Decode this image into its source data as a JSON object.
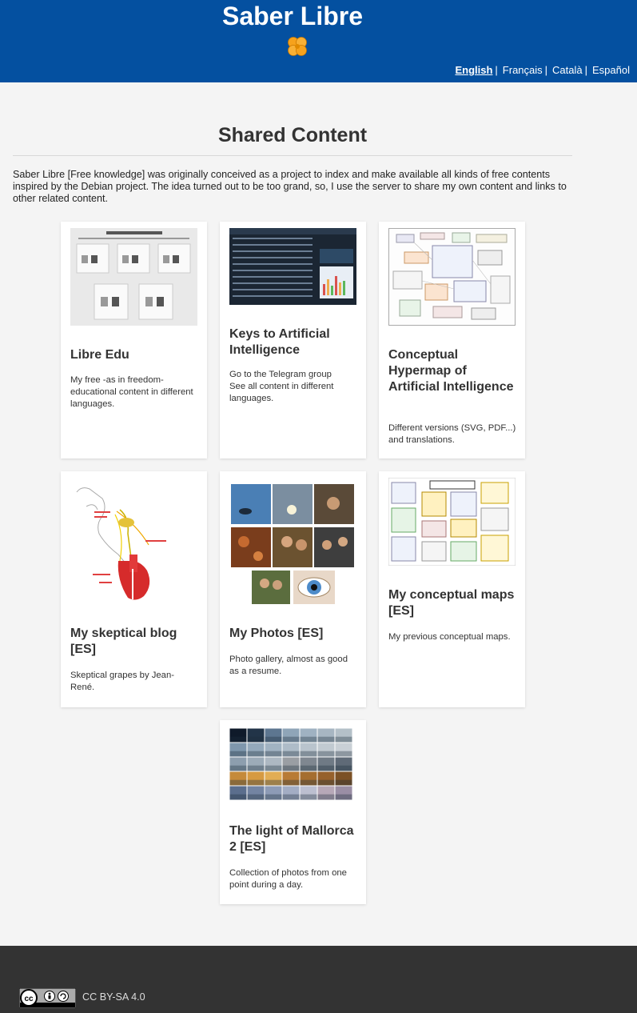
{
  "header": {
    "site_title": "Saber Libre",
    "languages": [
      {
        "label": "English",
        "active": true
      },
      {
        "label": "Français",
        "active": false
      },
      {
        "label": "Català",
        "active": false
      },
      {
        "label": "Español",
        "active": false
      }
    ],
    "separator": "|"
  },
  "main": {
    "title": "Shared Content",
    "intro": "Saber Libre [Free knowledge] was originally conceived as a project to index and make available all kinds of free contents inspired by the Debian project. The idea turned out to be too grand, so, I use the server to share my own content and links to other related content.",
    "cards": [
      {
        "title": "Libre Edu",
        "text": [
          "My free -as in freedom- educational content in different languages."
        ]
      },
      {
        "title": "Keys to Artificial Intelligence",
        "text": [
          "Go to the Telegram group",
          "See all content in different languages."
        ]
      },
      {
        "title": "Conceptual Hypermap of Artificial Intelligence",
        "text": [
          "Different versions (SVG, PDF...) and translations."
        ]
      },
      {
        "title": "My skeptical blog [ES]",
        "text": [
          "Skeptical grapes by Jean-René."
        ]
      },
      {
        "title": "My Photos [ES]",
        "text": [
          "Photo gallery, almost as good as a resume."
        ]
      },
      {
        "title": "My conceptual maps [ES]",
        "text": [
          "My previous conceptual maps."
        ]
      },
      {
        "title": "The light of Mallorca 2 [ES]",
        "text": [
          "Collection of photos from one point during a day."
        ]
      }
    ]
  },
  "footer": {
    "license": "CC BY-SA 4.0"
  },
  "colors": {
    "header_bg": "#0450a0",
    "footer_bg": "#333333",
    "page_bg": "#f4f4f4"
  }
}
